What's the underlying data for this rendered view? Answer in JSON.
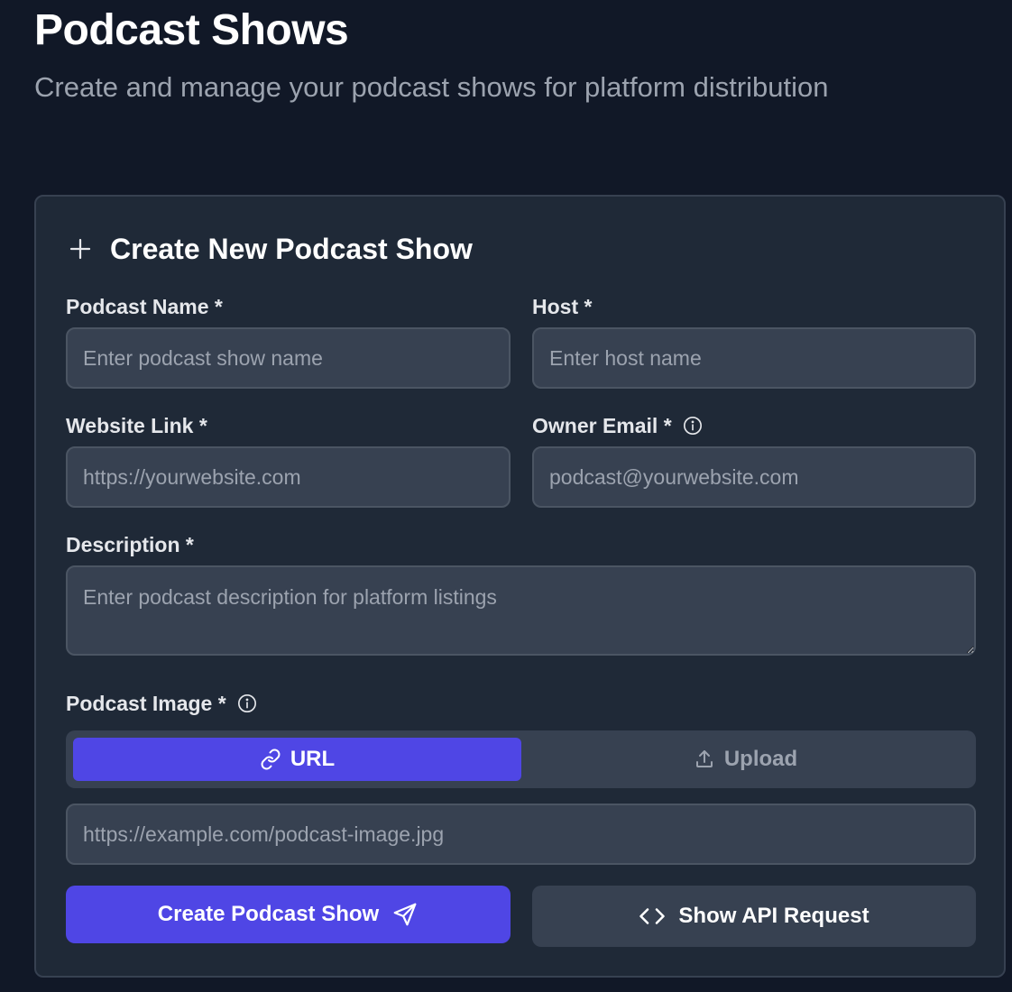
{
  "header": {
    "title": "Podcast Shows",
    "subtitle": "Create and manage your podcast shows for platform distribution"
  },
  "form": {
    "title": "Create New Podcast Show",
    "title_icon": "plus-icon",
    "fields": {
      "podcast_name": {
        "label": "Podcast Name *",
        "placeholder": "Enter podcast show name",
        "value": ""
      },
      "host": {
        "label": "Host *",
        "placeholder": "Enter host name",
        "value": ""
      },
      "website": {
        "label": "Website Link *",
        "placeholder": "https://yourwebsite.com",
        "value": ""
      },
      "owner_email": {
        "label": "Owner Email *",
        "placeholder": "podcast@yourwebsite.com",
        "value": "",
        "icon": "info-icon"
      },
      "description": {
        "label": "Description *",
        "placeholder": "Enter podcast description for platform listings",
        "value": ""
      },
      "image": {
        "label": "Podcast Image *",
        "icon": "info-icon",
        "mode_selected": "URL",
        "modes": [
          {
            "label": "URL",
            "icon": "link-icon",
            "active": true
          },
          {
            "label": "Upload",
            "icon": "upload-icon",
            "active": false
          }
        ],
        "placeholder": "https://example.com/podcast-image.jpg",
        "value": ""
      }
    },
    "actions": {
      "submit_label": "Create Podcast Show",
      "submit_icon": "send-icon",
      "api_label": "Show API Request",
      "api_icon": "code-icon"
    }
  },
  "colors": {
    "background": "#111827",
    "card": "#1f2937",
    "input": "#374151",
    "accent": "#4f46e5",
    "muted_text": "#9ca3af"
  }
}
